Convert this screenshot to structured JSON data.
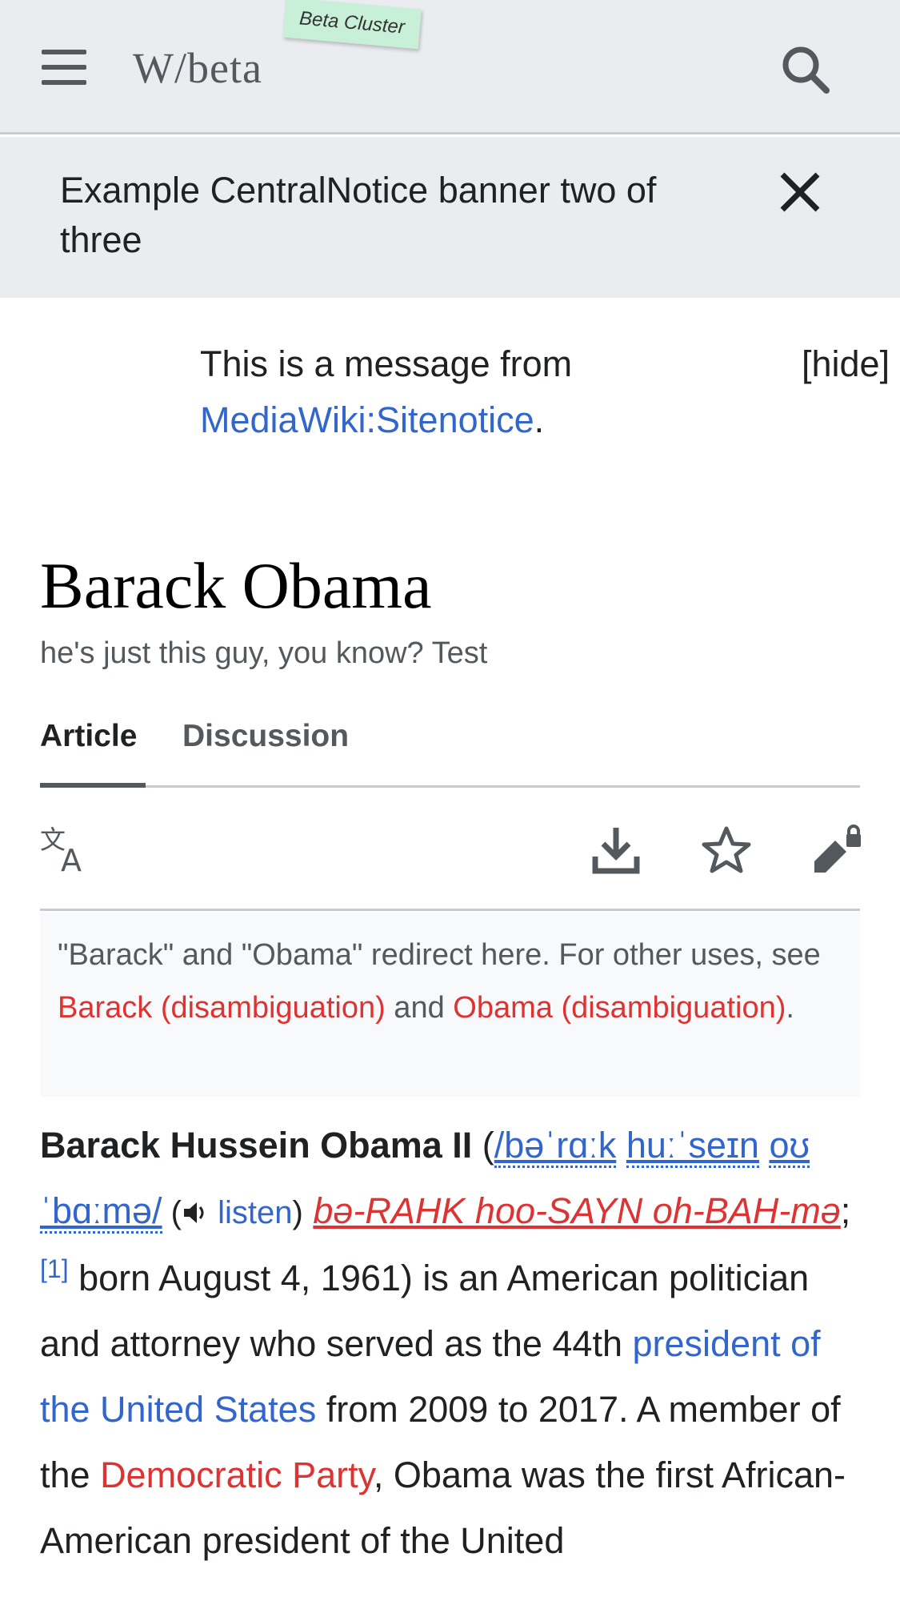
{
  "header": {
    "wordmark": "W/beta",
    "beta_tag": "Beta Cluster",
    "icons": {
      "menu": "hamburger-menu-icon",
      "search": "search-icon"
    }
  },
  "banner": {
    "text": "Example CentralNotice banner two of three",
    "close_icon": "close-icon"
  },
  "sitenotice": {
    "prefix": "This is a message from ",
    "link": "MediaWiki:Sitenotice",
    "suffix": ".",
    "hide_label": "[hide]"
  },
  "page": {
    "title": "Barack Obama",
    "description": "he's just this guy, you know? Test"
  },
  "tabs": [
    {
      "label": "Article",
      "active": true
    },
    {
      "label": "Discussion",
      "active": false
    }
  ],
  "actions": {
    "icons": [
      "language-icon",
      "download-icon",
      "watch-star-icon",
      "edit-lock-icon"
    ]
  },
  "hatnote": {
    "part1": "\"Barack\" and \"Obama\" redirect here. For other uses, see ",
    "link1": "Barack (disambiguation)",
    "part2": " and ",
    "link2": "Obama (disambiguation)",
    "part3": "."
  },
  "lead": {
    "name": "Barack Hussein Obama II",
    "open_paren": " (",
    "ipa1": "/bəˈrɑːk",
    "ipa2": "huːˈseɪn",
    "ipa3": "oʊˈbɑːmə/",
    "listen_open": " (",
    "listen_label": "listen",
    "listen_close": ")",
    "respell": "bə-RAHK hoo-SAYN oh-BAH-mə",
    "semicolon": ";",
    "ref": "[1]",
    "text1": " born August 4, 1961) is an American politician and attorney who served as the 44th ",
    "link_president": "president of the United States",
    "text2": " from 2009 to 2017. A member of the ",
    "link_party": "Democratic Party",
    "text3": ", Obama was the first African-American president of the United"
  },
  "colors": {
    "link_blue": "#3366cc",
    "link_red": "#dd3333",
    "chrome_gray": "#eaecf0"
  }
}
